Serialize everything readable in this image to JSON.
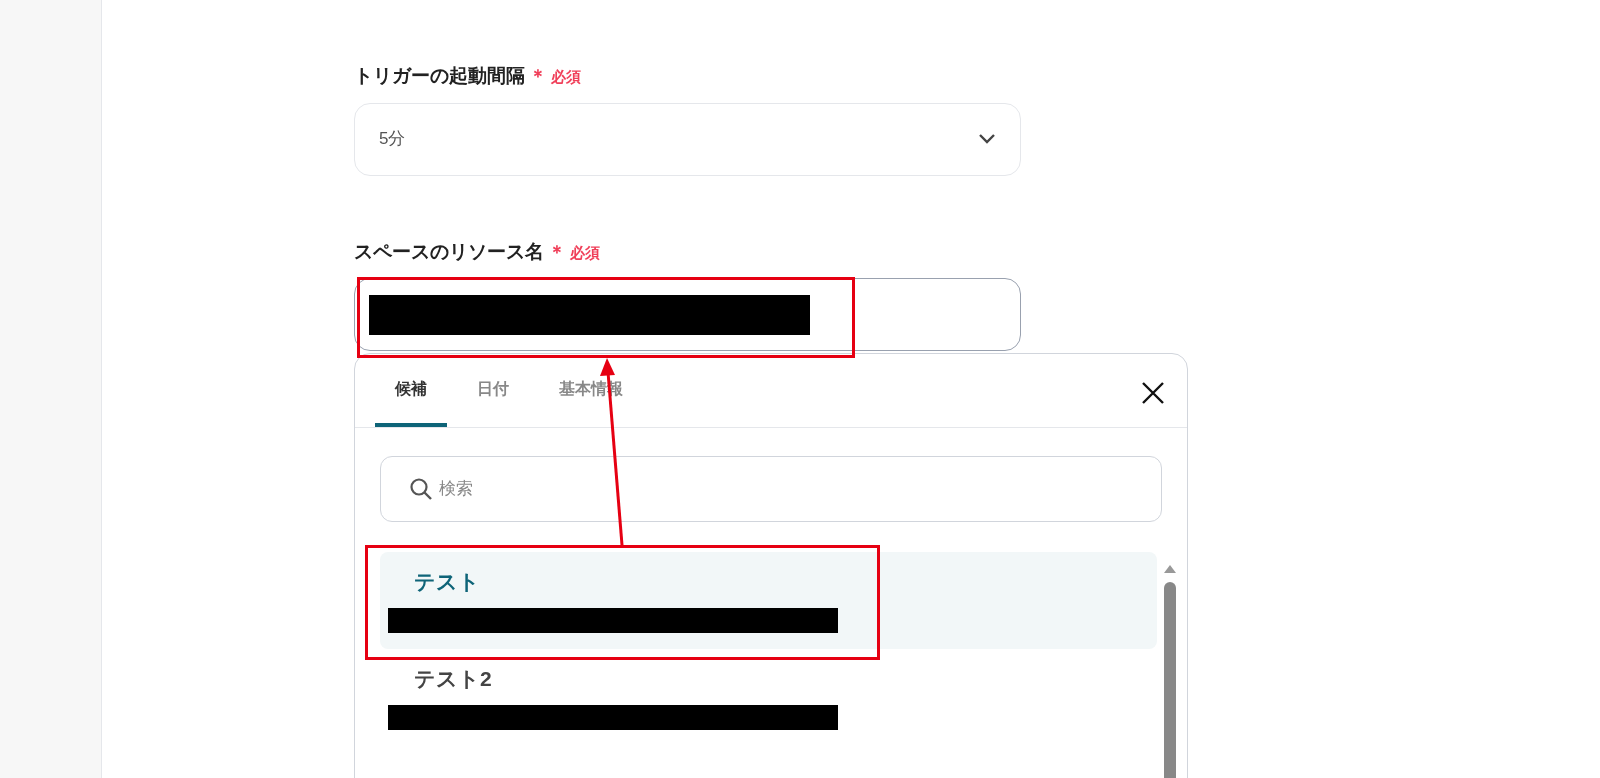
{
  "fields": [
    {
      "label": "トリガーの起動間隔",
      "required_mark": "＊",
      "required_label": "必須",
      "kind": "select",
      "value": "5分"
    },
    {
      "label": "スペースのリソース名",
      "required_mark": "＊",
      "required_label": "必須",
      "kind": "text"
    }
  ],
  "popup": {
    "tabs": [
      {
        "label": "候補",
        "selected": true
      },
      {
        "label": "日付",
        "selected": false
      },
      {
        "label": "基本情報",
        "selected": false
      }
    ],
    "search": {
      "placeholder": "検索"
    },
    "options": [
      {
        "title": "テスト",
        "selected": true
      },
      {
        "title": "テスト2",
        "selected": false
      }
    ]
  }
}
